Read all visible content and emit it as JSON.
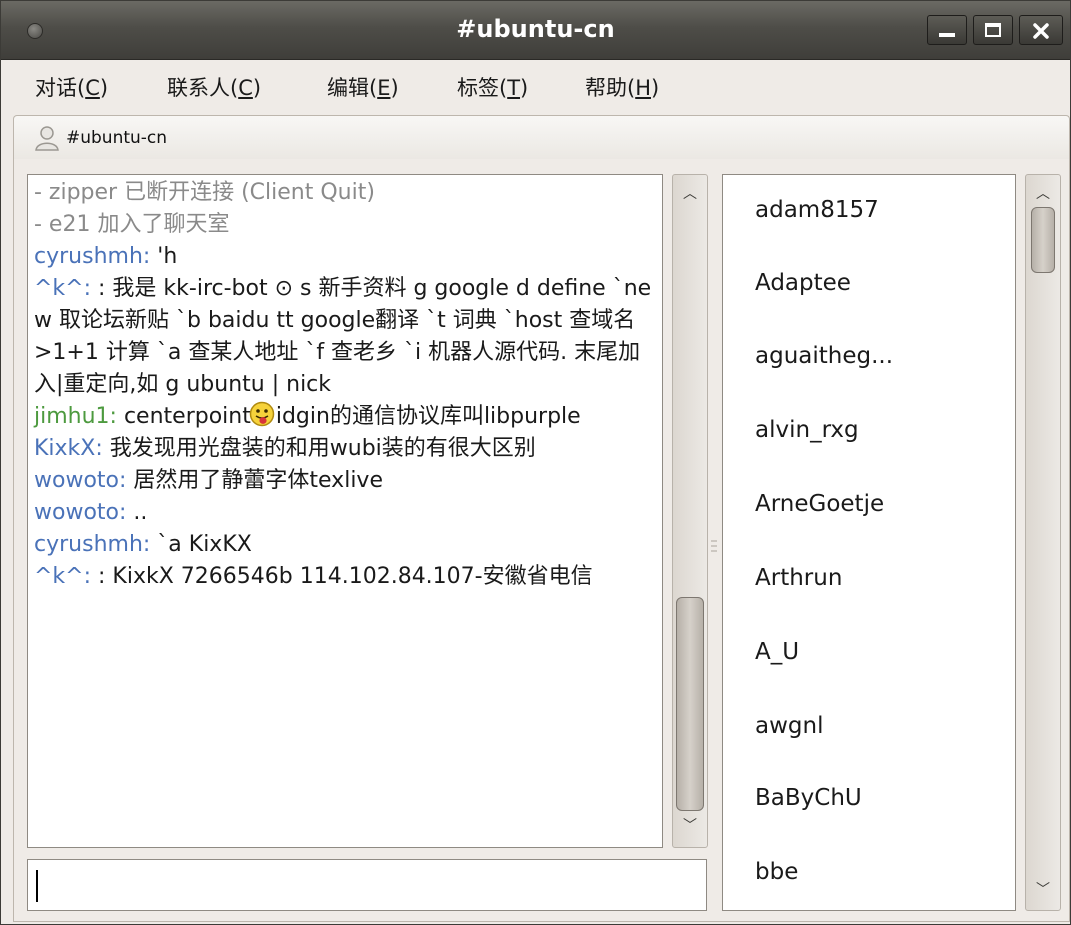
{
  "window": {
    "title": "#ubuntu-cn"
  },
  "menubar": [
    {
      "label": "对话(",
      "mnemonic": "C",
      "tail": ")"
    },
    {
      "label": "联系人(",
      "mnemonic": "C",
      "tail": ")"
    },
    {
      "label": "编辑(",
      "mnemonic": "E",
      "tail": ")"
    },
    {
      "label": "标签(",
      "mnemonic": "T",
      "tail": ")"
    },
    {
      "label": "帮助(",
      "mnemonic": "H",
      "tail": ")"
    }
  ],
  "tab": {
    "label": "#ubuntu-cn",
    "icon": "person-icon"
  },
  "chat": {
    "lines": [
      {
        "text": " - zipper 已断开连接 (Client Quit)"
      },
      {
        "text": " - e21 加入了聊天室"
      },
      {
        "nick": "cyrushmh: ",
        "msg": "'h"
      },
      {
        "nick": "^k^: ",
        "msg": ": 我是 kk-irc-bot ⊙ s 新手资料 g google d define `new 取论坛新贴 `b baidu tt google翻译 `t 词典 `host 查域名 >1+1 计算 `a 查某人地址 `f 查老乡 `i 机器人源代码. 末尾加入|重定向,如 g ubuntu | nick"
      },
      {
        "nick": "jimhu1: ",
        "msg_a": "centerpoint",
        "msg_b": "idgin的通信协议库叫libpurple",
        "emoticon": "tongue-emoticon"
      },
      {
        "nick": "KixkX: ",
        "msg": "我发现用光盘装的和用wubi装的有很大区别"
      },
      {
        "nick": "wowoto: ",
        "msg": "居然用了静蕾字体texlive"
      },
      {
        "nick": "wowoto: ",
        "msg": ".."
      },
      {
        "nick": "cyrushmh: ",
        "msg": "`a KixKX"
      },
      {
        "nick": "^k^: ",
        "msg": ": KixkX 7266546b 114.102.84.107-安徽省电信"
      }
    ]
  },
  "input": {
    "value": ""
  },
  "users": [
    "adam8157",
    "Adaptee",
    "aguaitheg...",
    "alvin_rxg",
    "ArneGoetje",
    "Arthrun",
    "A_U",
    "awgnl",
    "BaByChU",
    "bbe"
  ],
  "colors": {
    "nick_blue": "#4a72b8",
    "nick_green": "#4d9a3f",
    "system_gray": "#8a8a8a"
  }
}
